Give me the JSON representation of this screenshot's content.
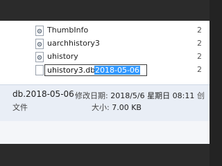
{
  "file_list": {
    "items": [
      {
        "name": "ThumbInfo",
        "date_partial": "2"
      },
      {
        "name": "uarchhistory3",
        "date_partial": "2"
      },
      {
        "name": "uhistory",
        "date_partial": "2"
      }
    ],
    "rename": {
      "stem": "uhistory3.db.",
      "selected": "2018-05-06",
      "date_partial": "2"
    }
  },
  "details": {
    "name": "db.2018-05-06",
    "type": "文件",
    "modified_label": "修改日期:",
    "modified_value": "2018/5/6 星期日 08:11",
    "modified_cut": "创",
    "size_label": "大小:",
    "size_value": "7.00 KB"
  },
  "colors": {
    "selection": "#3399ff",
    "details_bg": "#e9eef6"
  }
}
